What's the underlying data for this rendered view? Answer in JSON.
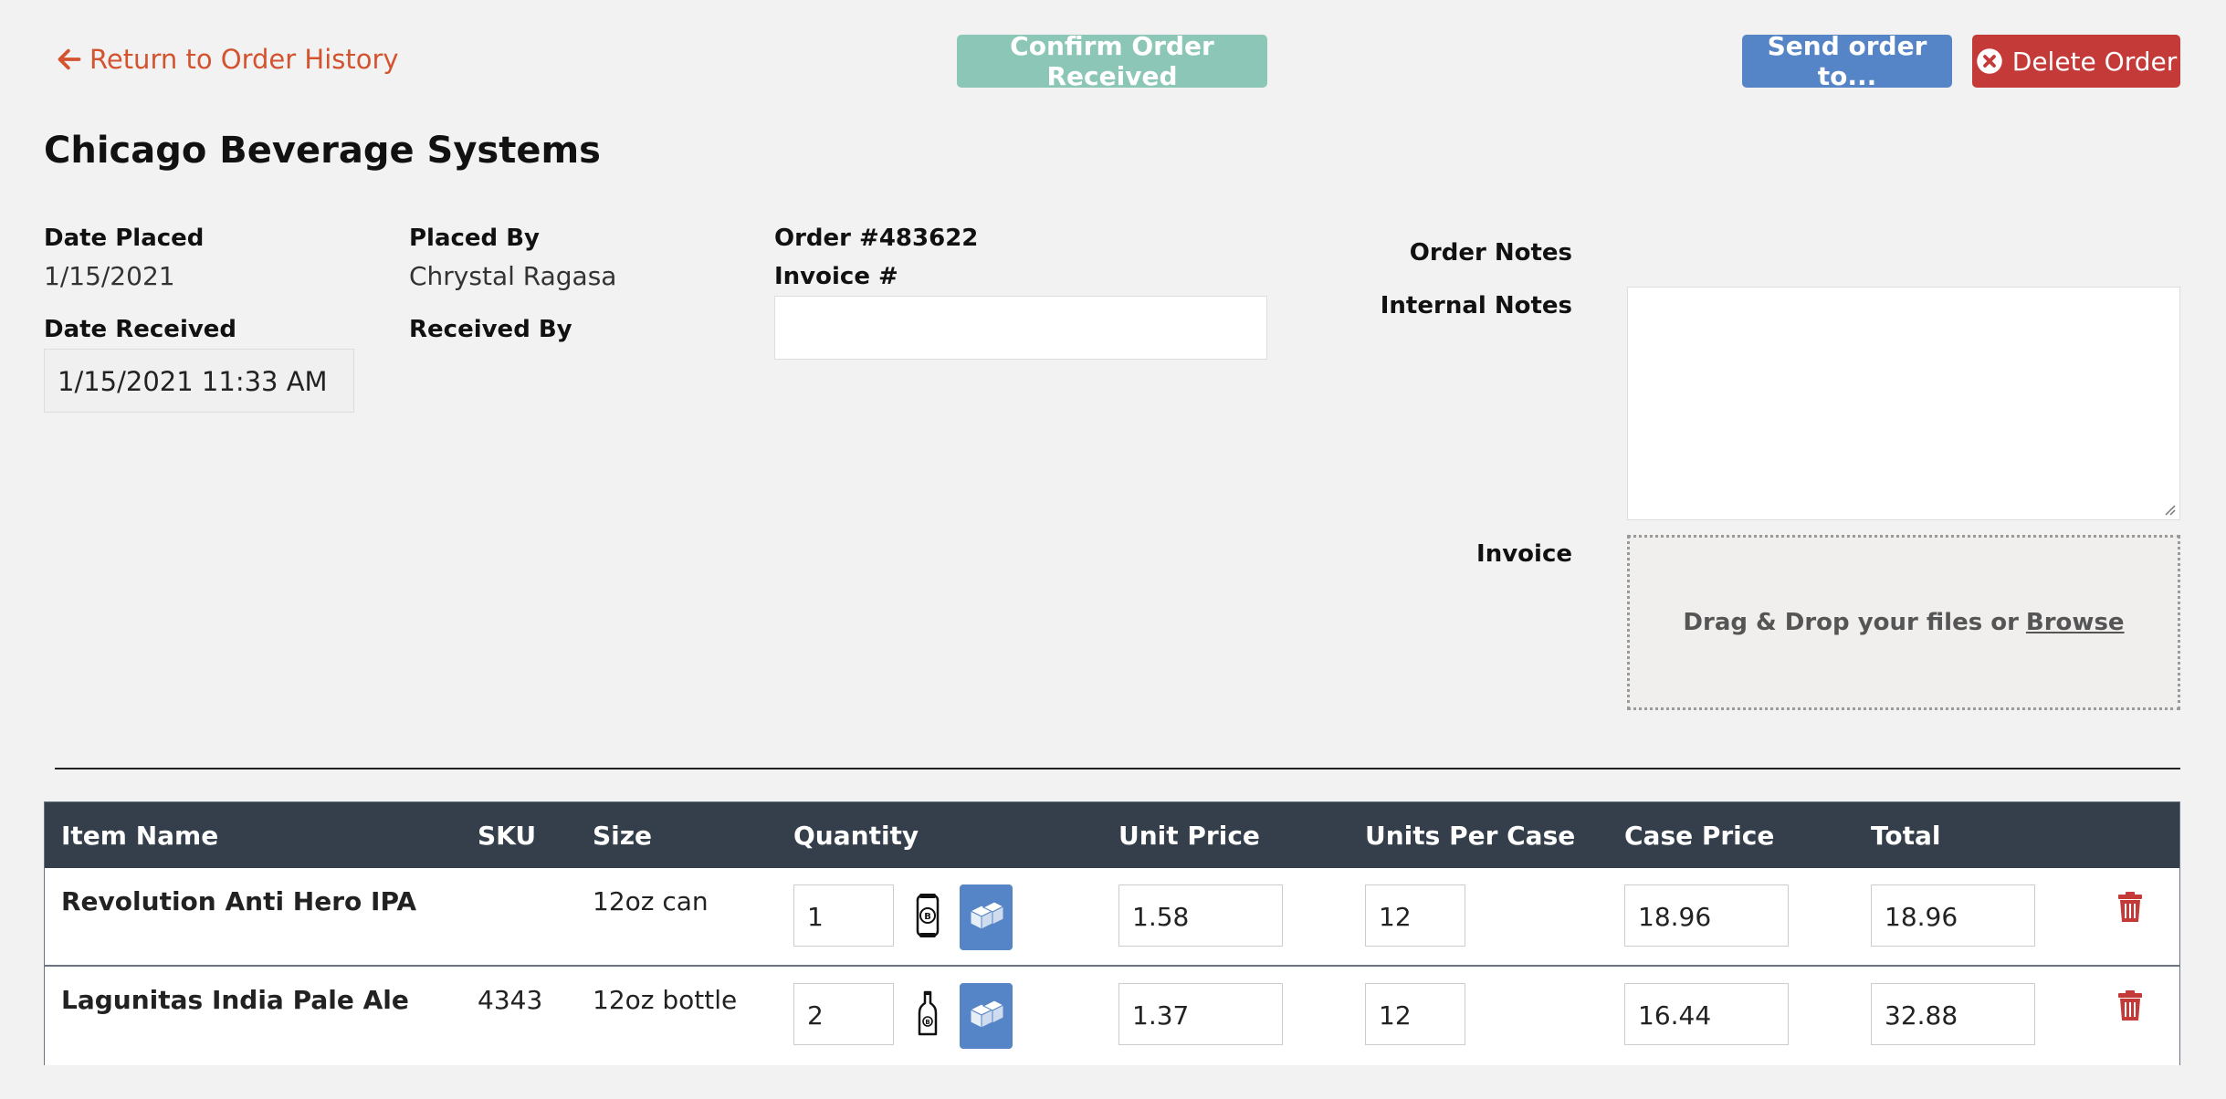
{
  "header": {
    "back_label": "Return to Order History",
    "confirm_label": "Confirm Order Received",
    "send_label": "Send order to...",
    "delete_label": "Delete Order"
  },
  "vendor": "Chicago Beverage Systems",
  "order": {
    "date_placed_label": "Date Placed",
    "date_placed": "1/15/2021",
    "placed_by_label": "Placed By",
    "placed_by": "Chrystal Ragasa",
    "order_number": "Order #483622",
    "invoice_label": "Invoice #",
    "invoice_value": "",
    "date_received_label": "Date Received",
    "date_received": "1/15/2021 11:33 AM",
    "received_by_label": "Received By"
  },
  "side": {
    "order_notes_label": "Order Notes",
    "internal_notes_label": "Internal Notes",
    "internal_notes_value": "",
    "invoice_label": "Invoice",
    "dropzone_text": "Drag & Drop your files or",
    "browse_label": "Browse"
  },
  "table": {
    "columns": [
      "Item Name",
      "SKU",
      "Size",
      "Quantity",
      "Unit Price",
      "Units Per Case",
      "Case Price",
      "Total"
    ],
    "rows": [
      {
        "name": "Revolution Anti Hero IPA",
        "sku": "",
        "size": "12oz can",
        "quantity": "1",
        "unit_icon": "beer-can-icon",
        "unit_price": "1.58",
        "units_per_case": "12",
        "case_price": "18.96",
        "total": "18.96"
      },
      {
        "name": "Lagunitas India Pale Ale",
        "sku": "4343",
        "size": "12oz bottle",
        "quantity": "2",
        "unit_icon": "beer-bottle-icon",
        "unit_price": "1.37",
        "units_per_case": "12",
        "case_price": "16.44",
        "total": "32.88"
      }
    ]
  },
  "colors": {
    "accent_link": "#d4532f",
    "confirm_button": "#8cc6b6",
    "send_button": "#5585c6",
    "delete_button": "#c43a38",
    "table_header": "#343f4b"
  }
}
